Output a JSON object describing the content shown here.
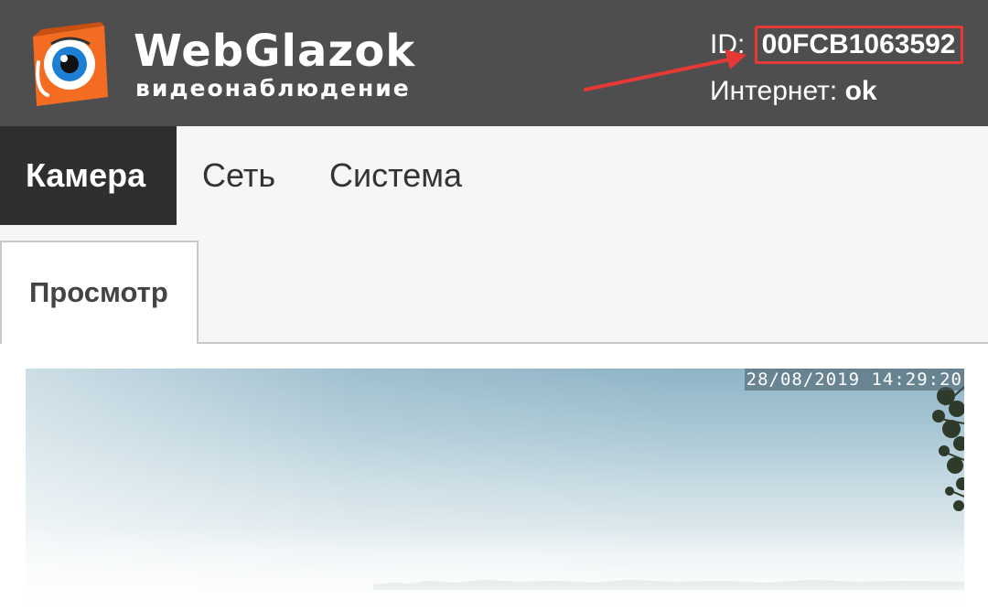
{
  "header": {
    "brand_name": "WebGlazok",
    "brand_sub": "видеонаблюдение",
    "id_label": "ID: ",
    "id_value": "00FCB1063592",
    "net_label": "Интернет: ",
    "net_value": "ok",
    "colors": {
      "background": "#4e4e4e",
      "highlight": "#e53935",
      "logo": "#f36c21"
    }
  },
  "nav": {
    "items": [
      {
        "label": "Камера",
        "active": true
      },
      {
        "label": "Сеть",
        "active": false
      },
      {
        "label": "Система",
        "active": false
      }
    ]
  },
  "subtabs": {
    "items": [
      {
        "label": "Просмотр",
        "active": true
      }
    ]
  },
  "video": {
    "timestamp": "28/08/2019 14:29:20"
  }
}
